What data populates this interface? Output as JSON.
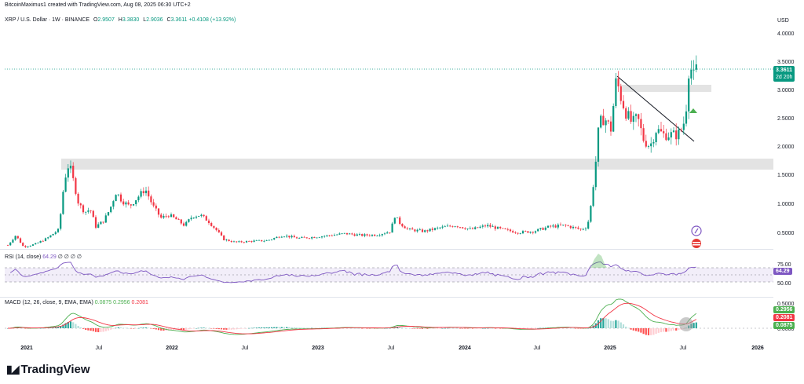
{
  "header": {
    "created_by": "BitcoinMaximus1 created with TradingView.com, Aug 08, 2025 06:30 UTC+2"
  },
  "symbol": {
    "name": "XRP / U.S. Dollar · 1W · BINANCE",
    "open_label": "O",
    "open": "2.9507",
    "high_label": "H",
    "high": "3.3830",
    "low_label": "L",
    "low": "2.9036",
    "close_label": "C",
    "close": "3.3611",
    "change": "+0.4108 (+13.92%)"
  },
  "price_axis": {
    "currency": "USD",
    "ticks": [
      "4.0000",
      "3.5000",
      "3.0000",
      "2.5000",
      "2.0000",
      "1.5000",
      "1.0000",
      "0.5000"
    ],
    "last_price": "3.3611",
    "countdown": "2d 20h"
  },
  "time_axis": {
    "ticks": [
      "2021",
      "Jul",
      "2022",
      "Jul",
      "2023",
      "Jul",
      "2024",
      "Jul",
      "2025",
      "Jul",
      "2026"
    ]
  },
  "rsi": {
    "label": "RSI (14, close)",
    "value": "64.29",
    "nulls": "∅ ∅ ∅ ∅",
    "ticks": [
      "75.00",
      "50.00"
    ],
    "tag": "64.29"
  },
  "macd": {
    "label": "MACD (12, 26, close, 9, EMA, EMA)",
    "hist": "0.0875",
    "macd": "0.2956",
    "signal": "0.2081",
    "ticks": [
      "0.5000",
      "0.0000"
    ],
    "tags": [
      "0.2956",
      "0.2081",
      "0.0875"
    ]
  },
  "footer": {
    "brand": "TradingView"
  },
  "colors": {
    "up": "#089981",
    "down": "#f23645",
    "rsi": "#7e57c2",
    "macd": "#4caf50",
    "signal": "#f23645"
  },
  "chart_data": {
    "type": "candlestick",
    "title": "XRP / U.S. Dollar · 1W · BINANCE",
    "ylabel": "USD",
    "ylim": [
      0.2,
      4.2
    ],
    "key_levels": {
      "last_close": 3.3611,
      "support_zone": [
        1.63,
        1.79
      ],
      "resistance_zone": [
        2.96,
        3.06
      ]
    },
    "approx_closes": [
      {
        "date": "2020-12",
        "close": 0.28
      },
      {
        "date": "2021-04",
        "close": 1.4
      },
      {
        "date": "2021-07",
        "close": 0.6
      },
      {
        "date": "2021-09",
        "close": 1.2
      },
      {
        "date": "2022-01",
        "close": 0.75
      },
      {
        "date": "2022-06",
        "close": 0.33
      },
      {
        "date": "2023-01",
        "close": 0.4
      },
      {
        "date": "2023-07",
        "close": 0.75
      },
      {
        "date": "2024-01",
        "close": 0.58
      },
      {
        "date": "2024-07",
        "close": 0.57
      },
      {
        "date": "2024-11",
        "close": 1.4
      },
      {
        "date": "2024-12",
        "close": 2.5
      },
      {
        "date": "2025-01",
        "close": 3.1
      },
      {
        "date": "2025-04",
        "close": 2.1
      },
      {
        "date": "2025-06",
        "close": 2.2
      },
      {
        "date": "2025-07",
        "close": 3.4
      },
      {
        "date": "2025-08",
        "close": 3.36
      }
    ]
  }
}
